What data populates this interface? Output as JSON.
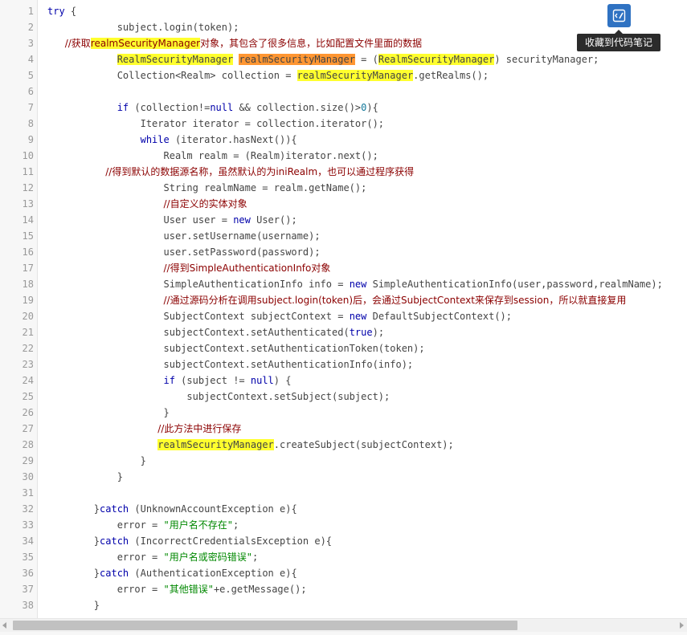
{
  "editor": {
    "line_numbers": [
      "1",
      "2",
      "3",
      "4",
      "5",
      "6",
      "7",
      "8",
      "9",
      "10",
      "11",
      "12",
      "13",
      "14",
      "15",
      "16",
      "17",
      "18",
      "19",
      "20",
      "21",
      "22",
      "23",
      "24",
      "25",
      "26",
      "27",
      "28",
      "29",
      "30",
      "31",
      "32",
      "33",
      "34",
      "35",
      "36",
      "37",
      "38"
    ],
    "lines": [
      [
        {
          "t": "try",
          "c": "kw"
        },
        {
          "t": " {"
        }
      ],
      [
        {
          "t": "            subject.login(token);"
        }
      ],
      [
        {
          "t": "   "
        },
        {
          "t": "//获取",
          "c": "cm"
        },
        {
          "t": "realmSecurityManager",
          "c": "cm hl"
        },
        {
          "t": "对象，其包含了很多信息，比如配置文件里面的数据",
          "c": "cm"
        }
      ],
      [
        {
          "t": "            "
        },
        {
          "t": "RealmSecurityManager",
          "c": "hl"
        },
        {
          "t": " "
        },
        {
          "t": "realmSecurityManager",
          "c": "hl2"
        },
        {
          "t": " = ("
        },
        {
          "t": "RealmSecurityManager",
          "c": "hl"
        },
        {
          "t": ") securityManager;"
        }
      ],
      [
        {
          "t": "            Collection<Realm> collection = "
        },
        {
          "t": "realmSecurityManager",
          "c": "hl"
        },
        {
          "t": ".getRealms();"
        }
      ],
      [],
      [
        {
          "t": "            "
        },
        {
          "t": "if",
          "c": "kw"
        },
        {
          "t": " (collection!="
        },
        {
          "t": "null",
          "c": "kw"
        },
        {
          "t": " && collection.size()>"
        },
        {
          "t": "0",
          "c": "num"
        },
        {
          "t": "){"
        }
      ],
      [
        {
          "t": "                Iterator iterator = collection.iterator();"
        }
      ],
      [
        {
          "t": "                "
        },
        {
          "t": "while",
          "c": "kw"
        },
        {
          "t": " (iterator.hasNext()){"
        }
      ],
      [
        {
          "t": "                    Realm realm = (Realm)iterator.next();"
        }
      ],
      [
        {
          "t": "          "
        },
        {
          "t": "//得到默认的数据源名称，虽然默认的为iniRealm，也可以通过程序获得",
          "c": "cm"
        }
      ],
      [
        {
          "t": "                    String realmName = realm.getName();"
        }
      ],
      [
        {
          "t": "                    "
        },
        {
          "t": "//自定义的实体对象",
          "c": "cm"
        }
      ],
      [
        {
          "t": "                    User user = "
        },
        {
          "t": "new",
          "c": "kw"
        },
        {
          "t": " User();"
        }
      ],
      [
        {
          "t": "                    user.setUsername(username);"
        }
      ],
      [
        {
          "t": "                    user.setPassword(password);"
        }
      ],
      [
        {
          "t": "                    "
        },
        {
          "t": "//得到SimpleAuthenticationInfo对象",
          "c": "cm"
        }
      ],
      [
        {
          "t": "                    SimpleAuthenticationInfo info = "
        },
        {
          "t": "new",
          "c": "kw"
        },
        {
          "t": " SimpleAuthenticationInfo(user,password,realmName);"
        }
      ],
      [
        {
          "t": "                    "
        },
        {
          "t": "//通过源码分析在调用subject.login(token)后，会通过SubjectContext来保存到session，所以就直接复用",
          "c": "cm"
        }
      ],
      [
        {
          "t": "                    SubjectContext subjectContext = "
        },
        {
          "t": "new",
          "c": "kw"
        },
        {
          "t": " DefaultSubjectContext();"
        }
      ],
      [
        {
          "t": "                    subjectContext.setAuthenticated("
        },
        {
          "t": "true",
          "c": "kw"
        },
        {
          "t": ");"
        }
      ],
      [
        {
          "t": "                    subjectContext.setAuthenticationToken(token);"
        }
      ],
      [
        {
          "t": "                    subjectContext.setAuthenticationInfo(info);"
        }
      ],
      [
        {
          "t": "                    "
        },
        {
          "t": "if",
          "c": "kw"
        },
        {
          "t": " (subject != "
        },
        {
          "t": "null",
          "c": "kw"
        },
        {
          "t": ") {"
        }
      ],
      [
        {
          "t": "                        subjectContext.setSubject(subject);"
        }
      ],
      [
        {
          "t": "                    }"
        }
      ],
      [
        {
          "t": "                   "
        },
        {
          "t": "//此方法中进行保存",
          "c": "cm"
        }
      ],
      [
        {
          "t": "                   "
        },
        {
          "t": "realmSecurityManager",
          "c": "hl"
        },
        {
          "t": ".createSubject(subjectContext);"
        }
      ],
      [
        {
          "t": "                }"
        }
      ],
      [
        {
          "t": "            }"
        }
      ],
      [],
      [
        {
          "t": "        }"
        },
        {
          "t": "catch",
          "c": "kw"
        },
        {
          "t": " (UnknownAccountException e){"
        }
      ],
      [
        {
          "t": "            error = "
        },
        {
          "t": "\"用户名不存在\"",
          "c": "str"
        },
        {
          "t": ";"
        }
      ],
      [
        {
          "t": "        }"
        },
        {
          "t": "catch",
          "c": "kw"
        },
        {
          "t": " (IncorrectCredentialsException e){"
        }
      ],
      [
        {
          "t": "            error = "
        },
        {
          "t": "\"用户名或密码错误\"",
          "c": "str"
        },
        {
          "t": ";"
        }
      ],
      [
        {
          "t": "        }"
        },
        {
          "t": "catch",
          "c": "kw"
        },
        {
          "t": " (AuthenticationException e){"
        }
      ],
      [
        {
          "t": "            error = "
        },
        {
          "t": "\"其他错误\"",
          "c": "str"
        },
        {
          "t": "+e.getMessage();"
        }
      ],
      [
        {
          "t": "        }"
        }
      ]
    ]
  },
  "toolbar": {
    "collect_icon": "code-note-icon",
    "collect_tooltip": "收藏到代码笔记"
  },
  "colors": {
    "keyword": "#0000aa",
    "string": "#008800",
    "comment": "#8b0000",
    "highlight": "#ffff2e",
    "highlight_active": "#ff9632",
    "button": "#2f72c2"
  }
}
